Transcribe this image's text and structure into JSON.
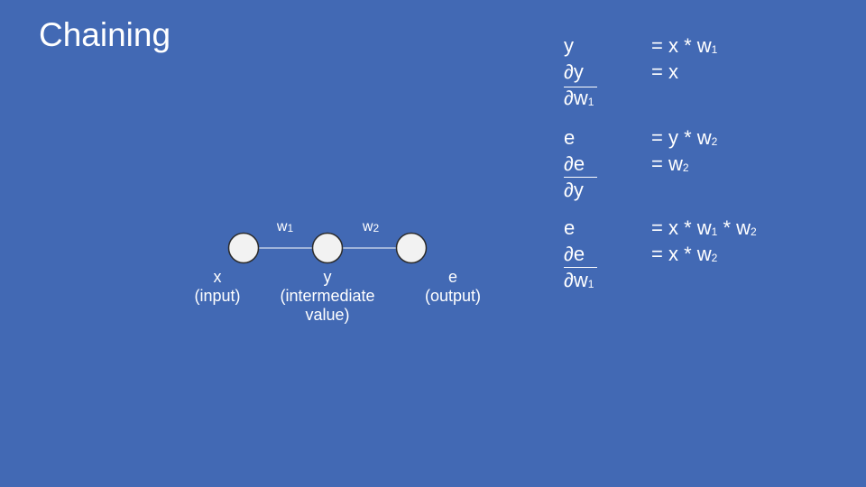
{
  "slide": {
    "title": "Chaining"
  },
  "diagram": {
    "weights": [
      {
        "base": "w",
        "sub": "1"
      },
      {
        "base": "w",
        "sub": "2"
      }
    ],
    "nodes": [
      {
        "name": "x",
        "desc": [
          "(input)"
        ]
      },
      {
        "name": "y",
        "desc": [
          "(intermediate",
          "value)"
        ]
      },
      {
        "name": "e",
        "desc": [
          "(output)"
        ]
      }
    ]
  },
  "equations": {
    "block1": {
      "lhs": "y",
      "rhs_parts": [
        "= x * w",
        "1"
      ],
      "d_num": "∂y",
      "d_rhs": "= x",
      "d_den_parts": [
        "∂w",
        "1"
      ]
    },
    "block2": {
      "lhs": "e",
      "rhs_parts": [
        "= y * w",
        "2"
      ],
      "d_num": "∂e",
      "d_rhs_parts": [
        "= w",
        "2"
      ],
      "d_den": "∂y"
    },
    "block3": {
      "lhs": "e",
      "rhs_parts": [
        "= x * w",
        "1",
        " * w",
        "2"
      ],
      "d_num": "∂e",
      "d_rhs_parts": [
        "= x * w",
        "2"
      ],
      "d_den_parts": [
        "∂w",
        "1"
      ]
    }
  }
}
